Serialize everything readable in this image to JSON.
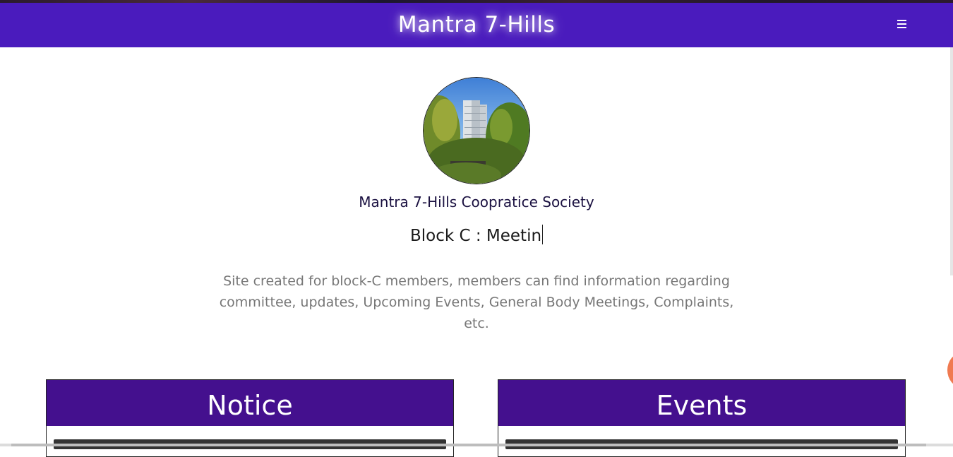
{
  "navbar": {
    "brand": "Mantra 7-Hills",
    "menu_icon": "hamburger-menu-icon",
    "background": "#4a1bbd"
  },
  "hero": {
    "avatar_alt": "tower-building-photo",
    "society_name": "Mantra 7-Hills Coopratice Society",
    "typed_text": "Block C :  Meetin",
    "description": "Site created for block-C members, members can find information regarding committee, updates, Upcoming Events, General Body Meetings, Complaints, etc."
  },
  "cards": {
    "notice_title": "Notice",
    "events_title": "Events",
    "header_color": "#44108e"
  }
}
